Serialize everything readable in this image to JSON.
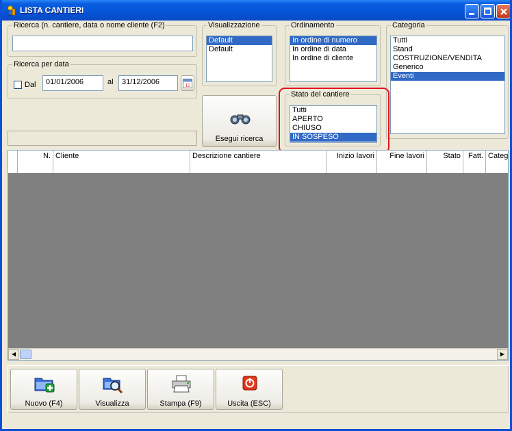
{
  "window": {
    "title": "LISTA CANTIERI"
  },
  "search": {
    "legend": "Ricerca (n. cantiere, data o nome cliente (F2)",
    "value": ""
  },
  "date_search": {
    "legend": "Ricerca per data",
    "from_label": "Dal",
    "from_value": "01/01/2006",
    "to_label": "al",
    "to_value": "31/12/2006",
    "checked": false
  },
  "visualizzazione": {
    "legend": "Visualizzazione",
    "items": [
      {
        "label": "Default",
        "selected": true
      },
      {
        "label": "Default",
        "selected": false
      }
    ]
  },
  "ordinamento": {
    "legend": "Ordinamento",
    "items": [
      {
        "label": "In ordine di numero",
        "selected": true
      },
      {
        "label": "In ordine di data",
        "selected": false
      },
      {
        "label": "In ordine di cliente",
        "selected": false
      }
    ]
  },
  "categoria": {
    "legend": "Categoria",
    "items": [
      {
        "label": "Tutti",
        "selected": false
      },
      {
        "label": "Stand",
        "selected": false
      },
      {
        "label": "COSTRUZIONE/VENDITA",
        "selected": false
      },
      {
        "label": "Generico",
        "selected": false
      },
      {
        "label": "Eventi",
        "selected": true
      }
    ]
  },
  "stato": {
    "legend": "Stato del cantiere",
    "items": [
      {
        "label": "Tutti",
        "selected": false
      },
      {
        "label": "APERTO",
        "selected": false
      },
      {
        "label": "CHIUSO",
        "selected": false
      },
      {
        "label": "IN SOSPESO",
        "selected": true
      }
    ]
  },
  "search_button": {
    "label": "Esegui ricerca",
    "icon": "binoculars-icon"
  },
  "grid": {
    "columns": [
      "",
      "N.",
      "Cliente",
      "Descrizione cantiere",
      "Inizio lavori",
      "Fine lavori",
      "Stato",
      "Fatt.",
      "Categ"
    ]
  },
  "toolbar": {
    "buttons": [
      {
        "label": "Nuovo (F4)",
        "icon": "new-folder-icon"
      },
      {
        "label": "Visualizza",
        "icon": "view-search-icon"
      },
      {
        "label": "Stampa (F9)",
        "icon": "printer-icon"
      },
      {
        "label": "Uscita (ESC)",
        "icon": "exit-icon"
      }
    ]
  },
  "colors": {
    "selection": "#316ac5",
    "highlight": "#e0121f",
    "titlebar": "#0553d6",
    "grid_bg": "#808080"
  }
}
